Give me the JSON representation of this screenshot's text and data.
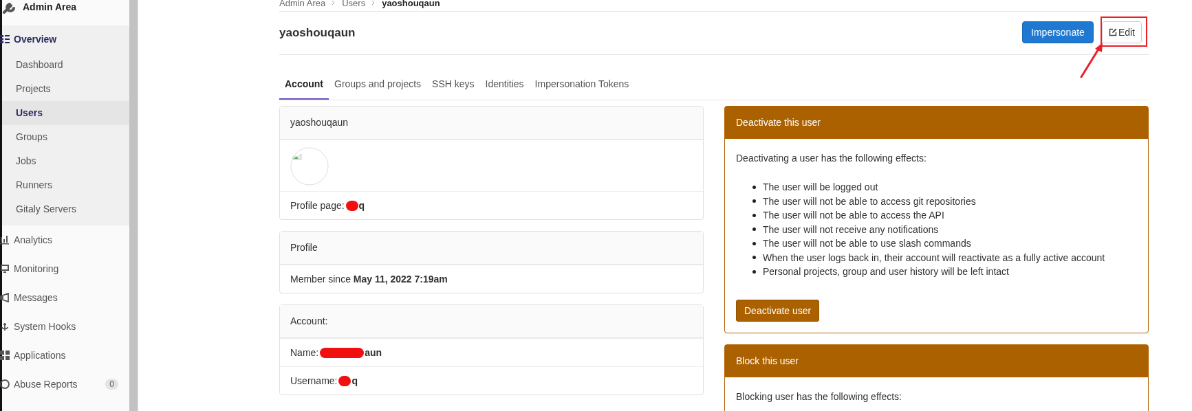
{
  "sidebar": {
    "title": "Admin Area",
    "sections": [
      {
        "label": "Overview",
        "selected": true,
        "children": [
          {
            "label": "Dashboard",
            "selected": false
          },
          {
            "label": "Projects",
            "selected": false
          },
          {
            "label": "Users",
            "selected": true
          },
          {
            "label": "Groups",
            "selected": false
          },
          {
            "label": "Jobs",
            "selected": false
          },
          {
            "label": "Runners",
            "selected": false
          },
          {
            "label": "Gitaly Servers",
            "selected": false
          }
        ]
      },
      {
        "label": "Analytics",
        "selected": false
      },
      {
        "label": "Monitoring",
        "selected": false
      },
      {
        "label": "Messages",
        "selected": false
      },
      {
        "label": "System Hooks",
        "selected": false
      },
      {
        "label": "Applications",
        "selected": false
      },
      {
        "label": "Abuse Reports",
        "selected": false,
        "badge": "0"
      }
    ]
  },
  "breadcrumb": [
    "Admin Area",
    "Users",
    "yaoshouqaun"
  ],
  "title": "yaoshouqaun",
  "buttons": [
    {
      "kind": "primary",
      "label": "Impersonate"
    },
    {
      "kind": "edit",
      "label": "Edit",
      "annotated": true
    }
  ],
  "tabs": [
    {
      "label": "Account",
      "selected": true
    },
    {
      "label": "Groups and projects",
      "selected": false
    },
    {
      "label": "SSH keys",
      "selected": false
    },
    {
      "label": "Identities",
      "selected": false
    },
    {
      "label": "Impersonation Tokens",
      "selected": false
    }
  ],
  "info_cards": [
    {
      "header": "yaoshouqaun",
      "rows": [
        {
          "kind": "avatar"
        },
        {
          "kind": "field",
          "label": "Profile page:",
          "value": "q",
          "redacted": true
        }
      ]
    },
    {
      "header": "Profile",
      "rows": [
        {
          "kind": "text",
          "text": "Member since **May 11, 2022 7:19am**"
        }
      ]
    },
    {
      "header": "Account:",
      "rows": [
        {
          "kind": "field",
          "label": "Name:",
          "value": "aun",
          "redacted": true
        },
        {
          "kind": "field",
          "label": "Username:",
          "value": "q",
          "redacted": true
        }
      ]
    }
  ],
  "danger_cards": [
    {
      "title": "Deactivate this user",
      "intro": "Deactivating a user has the following effects:",
      "effects": [
        "The user will be logged out",
        "The user will not be able to access git repositories",
        "The user will not be able to access the API",
        "The user will not receive any notifications",
        "The user will not be able to use slash commands",
        "When the user logs back in, their account will reactivate as a fully active account",
        "Personal projects, group and user history will be left intact"
      ],
      "button": "Deactivate user"
    },
    {
      "title": "Block this user",
      "intro": "Blocking user has the following effects:"
    }
  ]
}
